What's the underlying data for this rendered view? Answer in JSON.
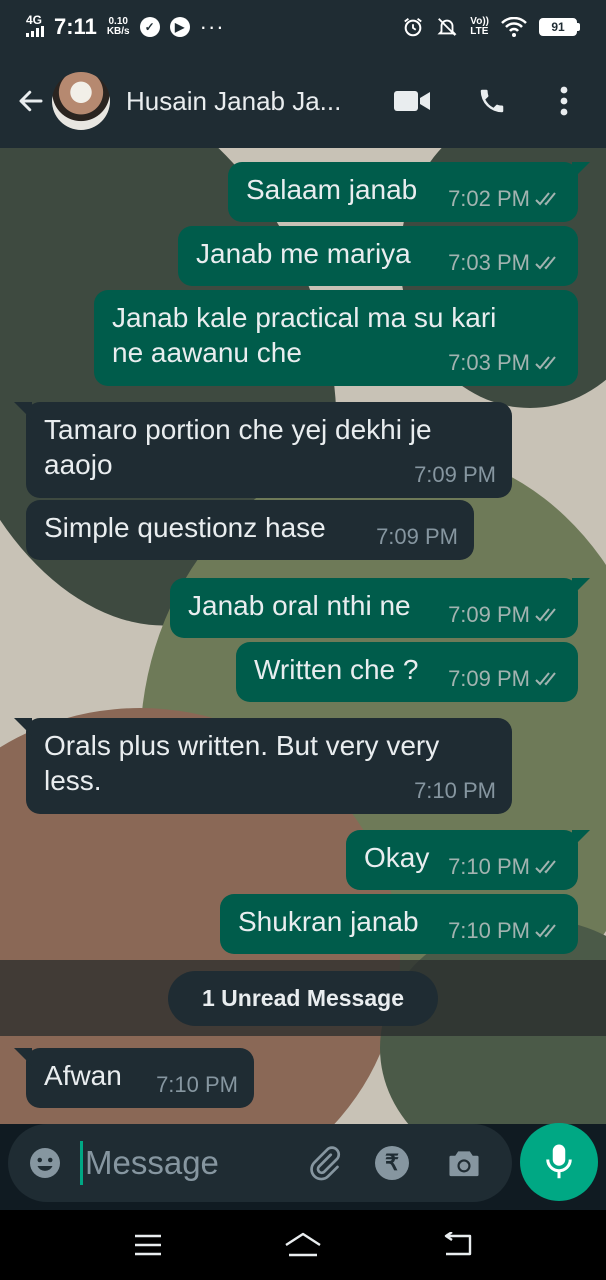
{
  "status_bar": {
    "network": "4G",
    "time": "7:11",
    "speed_value": "0.10",
    "speed_unit": "KB/s",
    "volte": "Vo))",
    "lte": "LTE",
    "battery": "91"
  },
  "header": {
    "contact_name": "Husain Janab Ja..."
  },
  "messages": [
    {
      "dir": "out",
      "text": "Salaam janab",
      "time": "7:02 PM"
    },
    {
      "dir": "out",
      "text": "Janab me mariya",
      "time": "7:03 PM"
    },
    {
      "dir": "out",
      "lines": [
        "Janab kale practical ma su kari",
        "ne aawanu che"
      ],
      "time": "7:03 PM"
    },
    {
      "dir": "in",
      "lines": [
        "Tamaro portion che yej dekhi je",
        "aaojo"
      ],
      "time": "7:09 PM"
    },
    {
      "dir": "in",
      "text": "Simple questionz hase",
      "time": "7:09 PM"
    },
    {
      "dir": "out",
      "text": "Janab oral nthi ne",
      "time": "7:09 PM"
    },
    {
      "dir": "out",
      "text": "Written che ?",
      "time": "7:09 PM"
    },
    {
      "dir": "in",
      "lines": [
        "Orals plus written. But very very",
        "less."
      ],
      "time": "7:10 PM"
    },
    {
      "dir": "out",
      "text": "Okay",
      "time": "7:10 PM"
    },
    {
      "dir": "out",
      "text": "Shukran janab",
      "time": "7:10 PM"
    },
    {
      "dir": "in",
      "text": "Afwan",
      "time": "7:10 PM"
    }
  ],
  "unread_label": "1 Unread Message",
  "input": {
    "placeholder": "Message",
    "value": "",
    "rupee_symbol": "₹"
  },
  "colors": {
    "outgoing_bubble": "#005c4b",
    "incoming_bubble": "#1f2c33",
    "accent": "#00a884",
    "header_bg": "#1f2c33"
  }
}
